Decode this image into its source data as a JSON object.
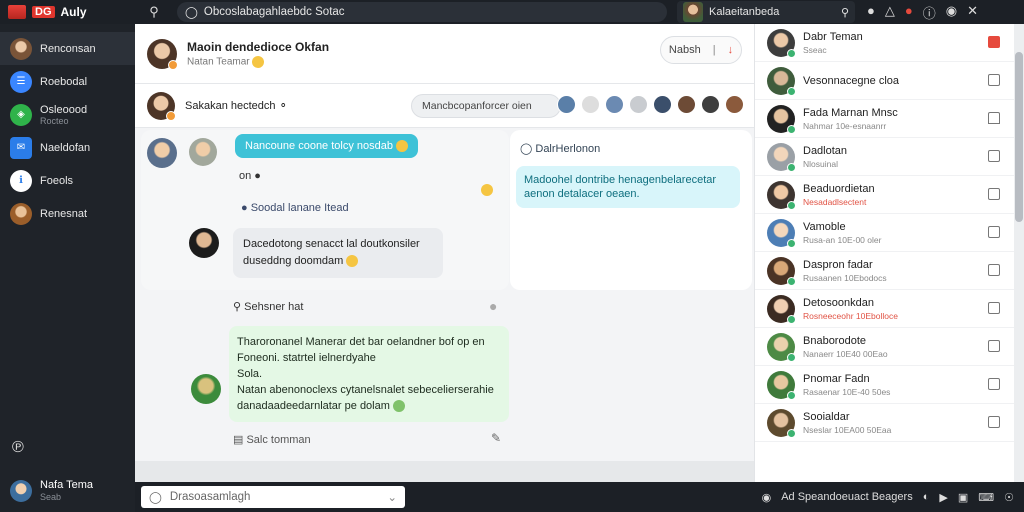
{
  "app": {
    "badge": "DG",
    "name": "Auly"
  },
  "top": {
    "search_value": "Obcoslabagahlaebdc Sotac",
    "user_name": "Kalaeitanbeda"
  },
  "sidebar": {
    "items": [
      {
        "label": "Renconsan",
        "sub": ""
      },
      {
        "label": "Roebodal",
        "sub": ""
      },
      {
        "label": "Osleoood",
        "sub": "Rocteo"
      },
      {
        "label": "Naeldofan",
        "sub": ""
      },
      {
        "label": "Foeols",
        "sub": ""
      },
      {
        "label": "Renesnat",
        "sub": ""
      }
    ],
    "user": {
      "name": "Nafa Tema",
      "status": "Seab"
    }
  },
  "chat": {
    "title": "Maoin dendedioce Okfan",
    "subtitle": "Natan Teamar",
    "header_button": "Nabsh",
    "subheader_title": "Sakakan hectedch",
    "pill_text": "Mancbcopanforcer oien",
    "thread": {
      "bubble1": "Nancoune coone tolcy nosdab",
      "line2": "on",
      "line3": "Soodal lanane Itead",
      "bubble2_l1": "Dacedotong senacct lal doutkonsiler",
      "bubble2_l2": "duseddng doomdam",
      "search_label": "Sehsner hat"
    },
    "right_thread": {
      "title": "DalrHerlonon",
      "bubble": "Madoohel dontribe henagenbelarecetar aenon detalacer oeaen."
    },
    "green": {
      "line1": "Tharoronanel Manerar det bar oelandner bof op en",
      "line2": "Foneoni. statrtel ielnerdyahe",
      "line3": "Sola.",
      "line4": "Natan abenonoclexs cytanelsnalet sebecelierserahie",
      "line5": "danadaadeedarnlatar pe dolam"
    },
    "footer_action": "Salc tomman"
  },
  "right_panel": {
    "rows": [
      {
        "name": "Dabr Teman",
        "sub": "Sseac",
        "sub_red": false,
        "icon": "red"
      },
      {
        "name": "Vesonnacegne cloa",
        "sub": "",
        "sub_red": false,
        "icon": "square"
      },
      {
        "name": "Fada Marnan Mnsc",
        "sub": "Nahmar 10e-esnaanrr",
        "sub_red": false,
        "icon": "bookmark"
      },
      {
        "name": "Dadlotan",
        "sub": "Nlosuinal",
        "sub_red": false,
        "icon": "square"
      },
      {
        "name": "Beaduordietan",
        "sub": "Nesadadlsectent",
        "sub_red": true,
        "icon": "bookmark"
      },
      {
        "name": "Vamoble",
        "sub": "Rusa-an 10E-00 oler",
        "sub_red": false,
        "icon": "bookmark"
      },
      {
        "name": "Daspron fadar",
        "sub": "Rusaanen 10Ebodocs",
        "sub_red": false,
        "icon": "square"
      },
      {
        "name": "Detosoonkdan",
        "sub": "Rosneeceohr 10Ebolloce",
        "sub_red": true,
        "icon": "square"
      },
      {
        "name": "Bnaborodote",
        "sub": "Nanaerr 10E40 00Eao",
        "sub_red": false,
        "icon": "bookmark"
      },
      {
        "name": "Pnomar Fadn",
        "sub": "Rasaenar 10E-40 50es",
        "sub_red": false,
        "icon": "square"
      },
      {
        "name": "Sooialdar",
        "sub": "Nseslar 10EA00 50Eaa",
        "sub_red": false,
        "icon": "square"
      }
    ]
  },
  "bottom": {
    "search_value": "Drasoasamlagh",
    "status_text": "Ad Speandoeuact Beagers"
  },
  "colors": {
    "accent": "#3ec2d7",
    "brand": "#e0352d",
    "green_bubble": "#e4f8e5",
    "dark": "#1c2026"
  }
}
